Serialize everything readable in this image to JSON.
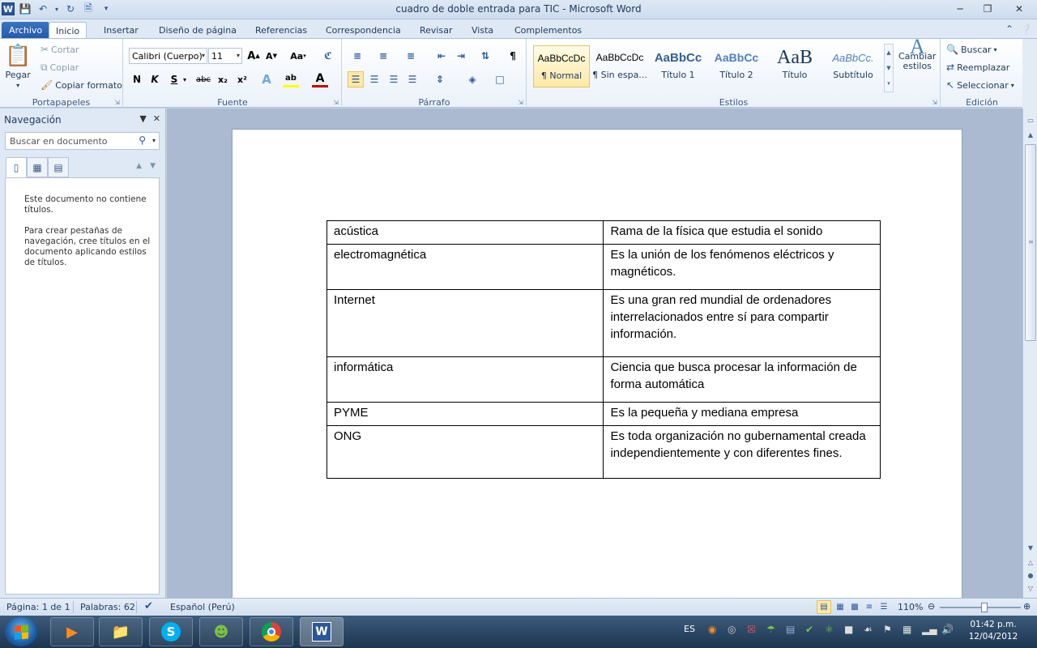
{
  "window": {
    "title": "cuadro de doble entrada para TIC  -  Microsoft Word"
  },
  "qat": {
    "app_icon_letter": "W"
  },
  "tabs": [
    {
      "label": "Archivo"
    },
    {
      "label": "Inicio"
    },
    {
      "label": "Insertar"
    },
    {
      "label": "Diseño de página"
    },
    {
      "label": "Referencias"
    },
    {
      "label": "Correspondencia"
    },
    {
      "label": "Revisar"
    },
    {
      "label": "Vista"
    },
    {
      "label": "Complementos"
    }
  ],
  "ribbon": {
    "clipboard": {
      "paste": "Pegar",
      "cut": "Cortar",
      "copy": "Copiar",
      "format_painter": "Copiar formato",
      "label": "Portapapeles"
    },
    "font": {
      "font_name": "Calibri (Cuerpo)",
      "font_size": "11",
      "bold": "N",
      "italic": "K",
      "underline": "S",
      "strike": "abc",
      "subscript": "x₂",
      "superscript": "x²",
      "case": "Aa",
      "grow": "A",
      "shrink": "A",
      "label": "Fuente"
    },
    "paragraph": {
      "label": "Párrafo"
    },
    "styles": {
      "items": [
        {
          "preview": "AaBbCcDc",
          "name": "¶ Normal"
        },
        {
          "preview": "AaBbCcDc",
          "name": "¶ Sin espa..."
        },
        {
          "preview": "AaBbCc",
          "name": "Título 1"
        },
        {
          "preview": "AaBbCc",
          "name": "Título 2"
        },
        {
          "preview": "AaB",
          "name": "Título"
        },
        {
          "preview": "AaBbCc.",
          "name": "Subtítulo"
        }
      ],
      "change_styles_line1": "Cambiar",
      "change_styles_line2": "estilos",
      "label": "Estilos"
    },
    "editing": {
      "find": "Buscar",
      "replace": "Reemplazar",
      "select": "Seleccionar",
      "label": "Edición"
    }
  },
  "navigation": {
    "title": "Navegación",
    "search_placeholder": "Buscar en documento",
    "message1": "Este documento no contiene títulos.",
    "message2": "Para crear pestañas de navegación, cree títulos en el documento aplicando estilos de títulos."
  },
  "document": {
    "table": [
      {
        "term": "acústica",
        "definition": "Rama de la física que estudia el sonido"
      },
      {
        "term": "electromagnética",
        "definition": "Es la unión de los fenómenos eléctricos y magnéticos."
      },
      {
        "term": "Internet",
        "definition": "Es una gran red mundial de ordenadores interrelacionados entre sí para compartir información."
      },
      {
        "term": "informática",
        "definition": "Ciencia que busca procesar la información de forma automática"
      },
      {
        "term": "PYME",
        "definition": "Es la pequeña y mediana empresa"
      },
      {
        "term": "ONG",
        "definition": "Es toda organización no gubernamental creada independientemente y con diferentes fines."
      }
    ]
  },
  "statusbar": {
    "page": "Página: 1 de 1",
    "words": "Palabras: 62",
    "language": "Español (Perú)",
    "zoom": "110%",
    "zoom_fraction": 0.55
  },
  "taskbar": {
    "lang": "ES",
    "time": "01:42 p.m.",
    "date": "12/04/2012"
  }
}
